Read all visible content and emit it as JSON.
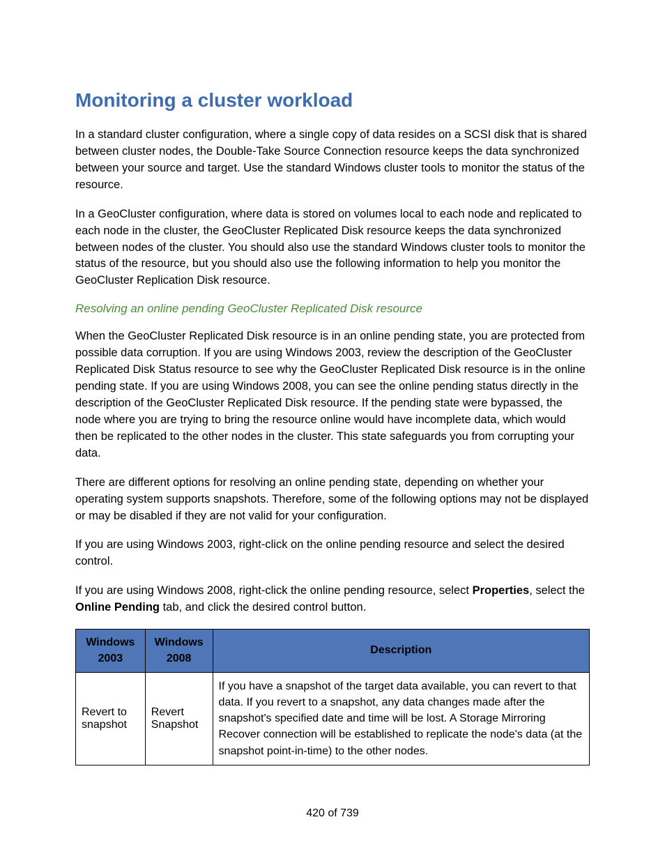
{
  "heading": "Monitoring a cluster workload",
  "para1": "In a standard cluster configuration, where a single copy of data resides on a SCSI disk that is shared between cluster nodes, the Double-Take Source Connection resource keeps the data synchronized between your source and target. Use the standard Windows cluster tools to monitor the status of the resource.",
  "para2": "In a GeoCluster configuration, where data is stored on volumes local to each node and replicated to each node in the cluster, the GeoCluster Replicated Disk resource keeps the data synchronized between nodes of the cluster. You should also use the standard Windows cluster tools to monitor the status of the resource, but you should also use the following information to help you monitor the GeoCluster Replication Disk resource.",
  "subheading": "Resolving an online pending GeoCluster Replicated Disk resource",
  "para3": "When the GeoCluster Replicated Disk resource is in an online pending state, you are protected from possible data corruption. If you are using Windows 2003, review the description of the GeoCluster Replicated Disk Status resource to see why the GeoCluster Replicated Disk resource is in the online pending state. If you are using Windows 2008, you can see the online pending status directly in the description of the GeoCluster Replicated Disk resource. If the pending state were bypassed, the node where you are trying to bring the resource online would have incomplete data, which would then be replicated to the other nodes in the cluster. This state safeguards you from corrupting your data.",
  "para4": "There are different options for resolving an online pending state, depending on whether your operating system supports snapshots. Therefore, some of the following options may not be displayed or may be disabled if they are not valid for your configuration.",
  "para5": "If you are using Windows 2003, right-click on the online pending resource and select the desired control.",
  "para6_pre": "If you are using Windows 2008, right-click the online pending resource, select ",
  "para6_b1": "Properties",
  "para6_mid": ", select the ",
  "para6_b2": "Online Pending",
  "para6_post": " tab, and click the desired control button.",
  "table": {
    "headers": {
      "col1_line1": "Windows",
      "col1_line2": "2003",
      "col2_line1": "Windows",
      "col2_line2": "2008",
      "col3": "Description"
    },
    "row1": {
      "c1": "Revert to snapshot",
      "c2": "Revert Snapshot",
      "c3": "If you have a snapshot of the target data available, you can revert to that data. If you revert to a snapshot, any data changes made after the snapshot's specified date and time will be lost. A Storage Mirroring Recover connection will be established to replicate the node's data (at the snapshot point-in-time) to the other nodes."
    }
  },
  "page_number": "420 of 739"
}
